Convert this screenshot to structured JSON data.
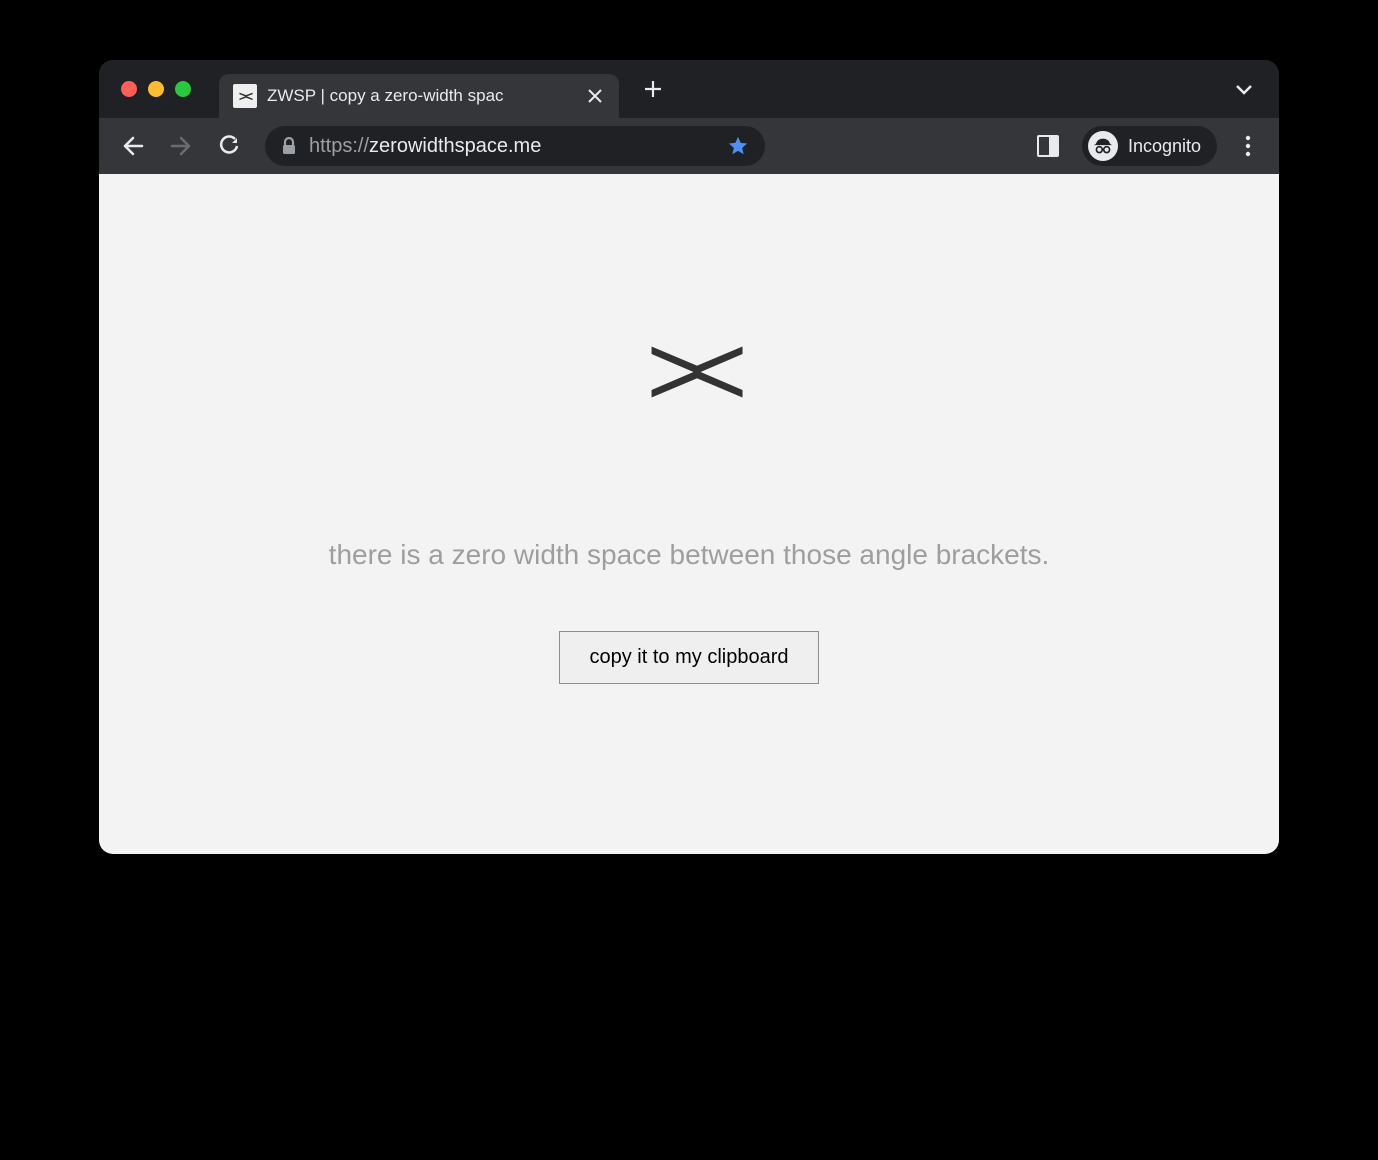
{
  "browser": {
    "tab": {
      "title": "ZWSP | copy a zero-width spac",
      "favicon_text": "><"
    },
    "url_protocol": "https://",
    "url_domain": "zerowidthspace.me",
    "incognito_label": "Incognito"
  },
  "page": {
    "brackets": ">​<",
    "description": "there is a zero width space between those angle brackets.",
    "copy_button_label": "copy it to my clipboard"
  }
}
